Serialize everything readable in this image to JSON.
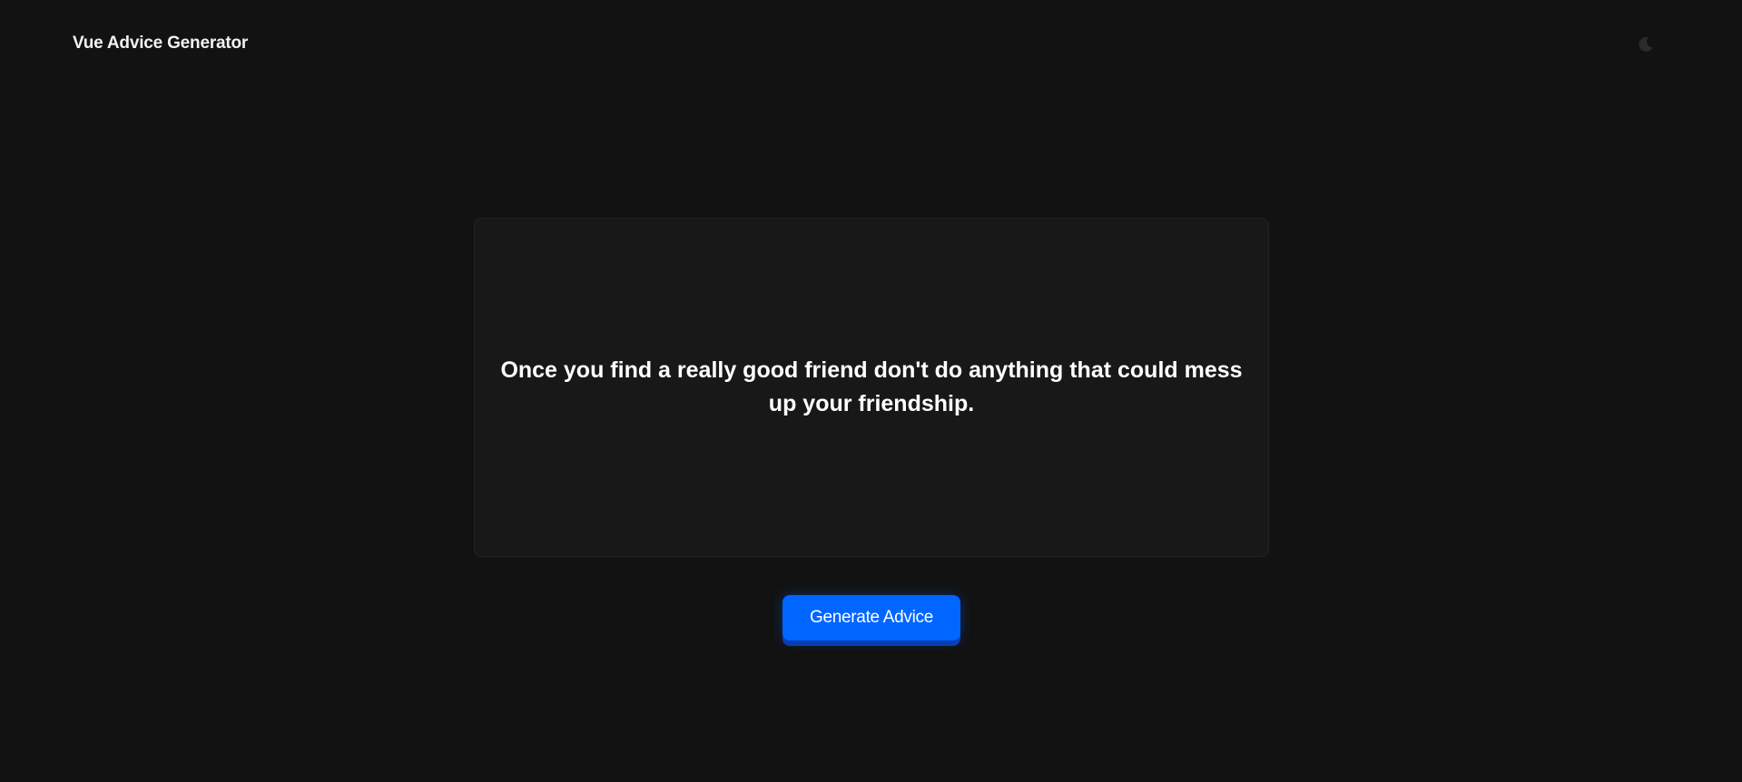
{
  "header": {
    "title": "Vue Advice Generator",
    "theme_toggle_icon": "moon-icon"
  },
  "advice": {
    "text": "Once you find a really good friend don't do anything that could mess up your friendship."
  },
  "actions": {
    "generate_label": "Generate Advice"
  },
  "colors": {
    "background": "#121212",
    "card": "#181818",
    "accent": "#0066ff",
    "text": "#ffffff"
  }
}
